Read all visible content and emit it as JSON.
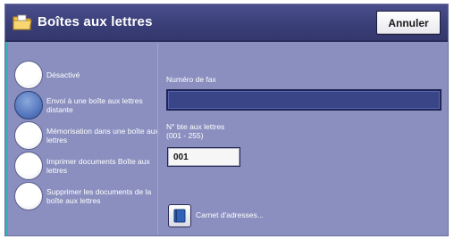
{
  "header": {
    "title": "Boîtes aux lettres",
    "cancel_label": "Annuler",
    "icon": "folder-icon"
  },
  "options": [
    {
      "label": "Désactivé",
      "selected": false
    },
    {
      "label": "Envoi à une boîte aux lettres distante",
      "selected": true
    },
    {
      "label": "Mémorisation dans une boîte aux lettres",
      "selected": false
    },
    {
      "label": "Imprimer documents Boîte aux lettres",
      "selected": false
    },
    {
      "label": "Supprimer les documents de la boîte aux lettres",
      "selected": false
    }
  ],
  "fax": {
    "label": "Numéro de fax",
    "value": ""
  },
  "mailbox": {
    "label_line1": "N° bte aux lettres",
    "label_line2": "(001 - 255)",
    "value": "001"
  },
  "address_book": {
    "label": "Carnet d'adresses...",
    "icon": "address-book-icon"
  },
  "colors": {
    "background": "#8a8fbf",
    "titlebar": "#3a3f78",
    "selected_radio": "#4d70b8",
    "fax_field": "#3a4587",
    "accent_strip": "#33b1b6"
  }
}
